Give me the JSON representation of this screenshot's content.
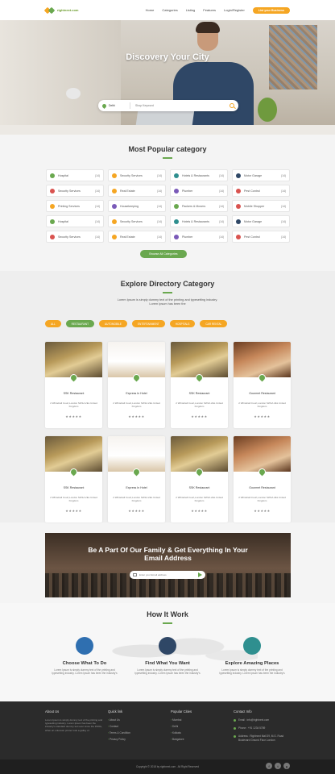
{
  "brand": {
    "logo_text": "rightnext.com",
    "colors": {
      "green": "#6aa84f",
      "orange": "#f5a623",
      "dark": "#2b2b2b"
    }
  },
  "nav": {
    "items": [
      "Home",
      "Categories",
      "Listing",
      "Features",
      "Login/Register"
    ],
    "cta": "List your Business"
  },
  "hero": {
    "title": "Discovery Your City",
    "city": "Delhi",
    "search_placeholder": "Shop Keyword"
  },
  "popular": {
    "title": "Most Popular category",
    "items": [
      {
        "label": "Hospital",
        "count": "(14)",
        "color": "#6aa84f"
      },
      {
        "label": "Security Services",
        "count": "(14)",
        "color": "#f5a623"
      },
      {
        "label": "Hotels & Restaurants",
        "count": "(14)",
        "color": "#2f8f8f"
      },
      {
        "label": "Motor Garage",
        "count": "(14)",
        "color": "#2f4766"
      },
      {
        "label": "Security Services",
        "count": "(14)",
        "color": "#d9534f"
      },
      {
        "label": "Real Estate",
        "count": "(14)",
        "color": "#f5a623"
      },
      {
        "label": "Plumber",
        "count": "(14)",
        "color": "#7a5ab8"
      },
      {
        "label": "Pest Control",
        "count": "(14)",
        "color": "#d9534f"
      },
      {
        "label": "Printing Services",
        "count": "(14)",
        "color": "#f5a623"
      },
      {
        "label": "Housekeeping",
        "count": "(14)",
        "color": "#7a5ab8"
      },
      {
        "label": "Packers & Movers",
        "count": "(14)",
        "color": "#6aa84f"
      },
      {
        "label": "Mobile Shopper",
        "count": "(14)",
        "color": "#d9534f"
      },
      {
        "label": "Hospital",
        "count": "(14)",
        "color": "#6aa84f"
      },
      {
        "label": "Security Services",
        "count": "(14)",
        "color": "#f5a623"
      },
      {
        "label": "Hotels & Restaurants",
        "count": "(14)",
        "color": "#2f8f8f"
      },
      {
        "label": "Motor Garage",
        "count": "(14)",
        "color": "#2f4766"
      },
      {
        "label": "Security Services",
        "count": "(14)",
        "color": "#d9534f"
      },
      {
        "label": "Real Estate",
        "count": "(14)",
        "color": "#f5a623"
      },
      {
        "label": "Plumber",
        "count": "(14)",
        "color": "#7a5ab8"
      },
      {
        "label": "Pest Control",
        "count": "(14)",
        "color": "#d9534f"
      }
    ],
    "browse_label": "Browse All Categories"
  },
  "directory": {
    "title": "Explore Directory Category",
    "lead_1": "Lorem Ipsum is simply dummy text of the printing and typesetting industry.",
    "lead_2": "Lorem Ipsum has been the",
    "filters": [
      "ALL",
      "RESTAURANT",
      "AUTOMOBILE",
      "ENTERTAINMENT",
      "HOSPITALS",
      "CAR RENTAL"
    ],
    "cards": [
      {
        "name": "SSK Restaurant",
        "address": "2 Whitehall Court,London SW1A 2EL United Kingdom",
        "stars": "★★★★★",
        "img": "alt1"
      },
      {
        "name": "Express In Hotel",
        "address": "2 Whitehall Court,London SW1A 2EL United Kingdom",
        "stars": "★★★★★",
        "img": "alt2"
      },
      {
        "name": "SSK Restaurant",
        "address": "2 Whitehall Court,London SW1A 2EL United Kingdom",
        "stars": "★★★★★",
        "img": "alt1"
      },
      {
        "name": "Gourmet Restaurant",
        "address": "2 Whitehall Court,London SW1A 2EL United Kingdom",
        "stars": "★★★★★",
        "img": "alt4"
      },
      {
        "name": "SSK Restaurant",
        "address": "2 Whitehall Court,London SW1A 2EL United Kingdom",
        "stars": "★★★★★",
        "img": "alt1"
      },
      {
        "name": "Express In Hotel",
        "address": "2 Whitehall Court,London SW1A 2EL United Kingdom",
        "stars": "★★★★★",
        "img": "alt2"
      },
      {
        "name": "SSK Restaurant",
        "address": "2 Whitehall Court,London SW1A 2EL United Kingdom",
        "stars": "★★★★★",
        "img": "alt1"
      },
      {
        "name": "Gourmet Restaurant",
        "address": "2 Whitehall Court,London SW1A 2EL United Kingdom",
        "stars": "★★★★★",
        "img": "alt4"
      }
    ]
  },
  "newsletter": {
    "title_1": "Be A Part Of Our Family & Get Everything In Your",
    "title_2": "Email Address",
    "placeholder": "Enter your Email address"
  },
  "how": {
    "title": "How It Work",
    "steps": [
      {
        "title": "Choose What To Do",
        "text": "Lorem Ipsum is simply dummy text of the printing and typesetting industry. Lorem Ipsum has been the industry's",
        "icon": "bulb-head-icon",
        "color": "#2f6fb0"
      },
      {
        "title": "Find What You Want",
        "text": "Lorem Ipsum is simply dummy text of the printing and typesetting industry. Lorem Ipsum has been the industry's",
        "icon": "magnifier-icon",
        "color": "#2f4766"
      },
      {
        "title": "Explore Amazing Places",
        "text": "Lorem Ipsum is simply dummy text of the printing and typesetting industry. Lorem Ipsum has been the industry's",
        "icon": "mountain-icon",
        "color": "#2f8f8f"
      }
    ]
  },
  "footer": {
    "about_title": "About Us",
    "about_text": "Lorem Ipsum is simply dummy text of the printing and typesetting industry. Lorem Ipsum has been the industry's standard dummy text ever since the 1500s, when an unknown printer took a galley of",
    "links_title": "Quick link",
    "links": [
      "About Us",
      "Contact",
      "Terms & Condition",
      "Privacy Policy"
    ],
    "cities_title": "Popular Cities",
    "cities": [
      "Mumbai",
      "Delhi",
      "Kolkata",
      "Bangalore"
    ],
    "contact_title": "Contact Info",
    "email": "Email : info@rightnext.com",
    "phone": "Phone : +91 1234 5789",
    "address": "Address : Rightnext Mall 39, M.G. Road Boulevard Ground Floor London",
    "copyright": "Copyright © 2018 by rightnext.com . All Right Reserved",
    "social": [
      "f",
      "t",
      "g"
    ]
  }
}
